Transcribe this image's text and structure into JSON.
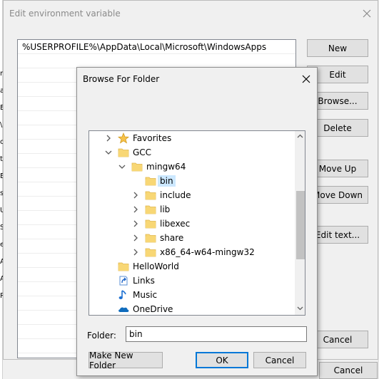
{
  "background": {
    "left_fragments": [
      "r",
      "a",
      "E",
      "\\",
      "c",
      "t",
      "E",
      "s",
      "U",
      "S",
      "e",
      "A",
      "A",
      "R"
    ]
  },
  "env_window": {
    "title": "Edit environment variable",
    "list_rows": [
      "%USERPROFILE%\\AppData\\Local\\Microsoft\\WindowsApps",
      "",
      "",
      "",
      "",
      "",
      "",
      "",
      "",
      "",
      "",
      "",
      "",
      "",
      "",
      "",
      "",
      "",
      "",
      "",
      "",
      ""
    ],
    "buttons": {
      "new": "New",
      "edit": "Edit",
      "browse": "Browse...",
      "delete": "Delete",
      "move_up": "Move Up",
      "move_down": "Move Down",
      "edit_text": "Edit text...",
      "cancel": "Cancel"
    },
    "outer_cancel": "Cancel"
  },
  "browse_dialog": {
    "title": "Browse For Folder",
    "tree": [
      {
        "label": "Favorites",
        "icon": "star-icon",
        "indent": 0,
        "expander": "collapsed"
      },
      {
        "label": "GCC",
        "icon": "folder-icon",
        "indent": 0,
        "expander": "expanded"
      },
      {
        "label": "mingw64",
        "icon": "folder-icon",
        "indent": 1,
        "expander": "expanded"
      },
      {
        "label": "bin",
        "icon": "folder-icon",
        "indent": 2,
        "expander": "none",
        "selected": true
      },
      {
        "label": "include",
        "icon": "folder-icon",
        "indent": 2,
        "expander": "collapsed"
      },
      {
        "label": "lib",
        "icon": "folder-icon",
        "indent": 2,
        "expander": "collapsed"
      },
      {
        "label": "libexec",
        "icon": "folder-icon",
        "indent": 2,
        "expander": "collapsed"
      },
      {
        "label": "share",
        "icon": "folder-icon",
        "indent": 2,
        "expander": "collapsed"
      },
      {
        "label": "x86_64-w64-mingw32",
        "icon": "folder-icon",
        "indent": 2,
        "expander": "collapsed"
      },
      {
        "label": "HelloWorld",
        "icon": "folder-icon",
        "indent": 0,
        "expander": "none"
      },
      {
        "label": "Links",
        "icon": "links-icon",
        "indent": 0,
        "expander": "none"
      },
      {
        "label": "Music",
        "icon": "music-icon",
        "indent": 0,
        "expander": "none"
      },
      {
        "label": "OneDrive",
        "icon": "onedrive-icon",
        "indent": 0,
        "expander": "none"
      }
    ],
    "folder_label": "Folder:",
    "folder_value": "bin",
    "make_new_folder": "Make New Folder",
    "ok": "OK",
    "cancel": "Cancel"
  },
  "colors": {
    "selection": "#cce8ff",
    "folder": "#f8d775",
    "folder_dark": "#e0b64c",
    "accent": "#0078d7"
  }
}
